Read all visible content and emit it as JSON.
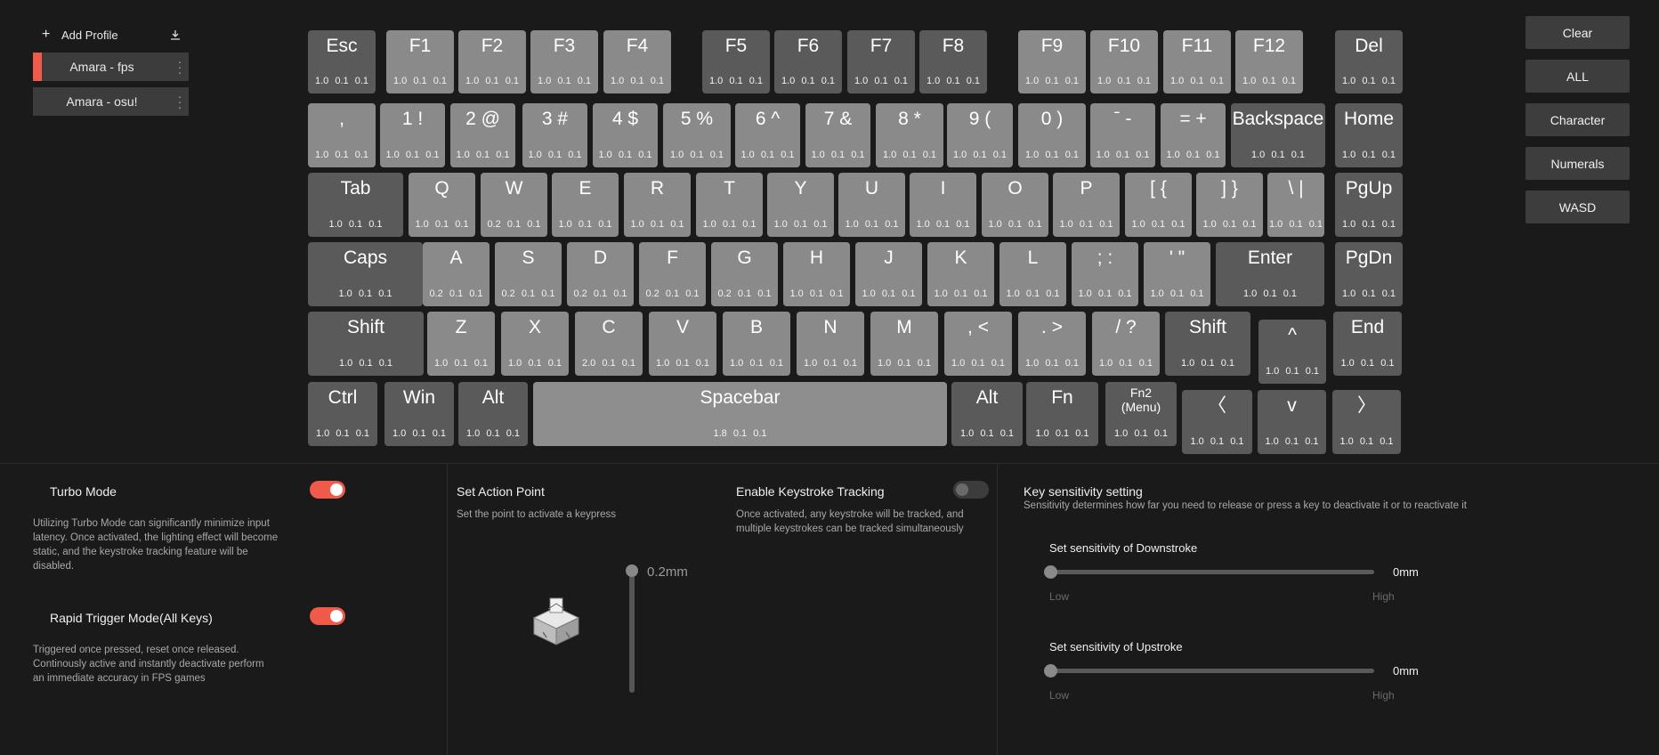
{
  "sidebar": {
    "add_profile": "Add Profile",
    "profiles": [
      {
        "name": "Amara - fps",
        "active": true
      },
      {
        "name": "Amara - osu!",
        "active": false
      }
    ]
  },
  "right_buttons": [
    "Clear",
    "ALL",
    "Character",
    "Numerals",
    "WASD"
  ],
  "keys": [
    {
      "l": "Esc",
      "v": "1.0  0.1  0.1",
      "s": "dark"
    },
    {
      "l": "F1",
      "v": "1.0  0.1  0.1",
      "s": "light"
    },
    {
      "l": "F2",
      "v": "1.0  0.1  0.1",
      "s": "light"
    },
    {
      "l": "F3",
      "v": "1.0  0.1  0.1",
      "s": "light"
    },
    {
      "l": "F4",
      "v": "1.0  0.1  0.1",
      "s": "light"
    },
    {
      "l": "F5",
      "v": "1.0  0.1  0.1",
      "s": "dark"
    },
    {
      "l": "F6",
      "v": "1.0  0.1  0.1",
      "s": "dark"
    },
    {
      "l": "F7",
      "v": "1.0  0.1  0.1",
      "s": "dark"
    },
    {
      "l": "F8",
      "v": "1.0  0.1  0.1",
      "s": "dark"
    },
    {
      "l": "F9",
      "v": "1.0  0.1  0.1",
      "s": "light"
    },
    {
      "l": "F10",
      "v": "1.0  0.1  0.1",
      "s": "light"
    },
    {
      "l": "F11",
      "v": "1.0  0.1  0.1",
      "s": "light"
    },
    {
      "l": "F12",
      "v": "1.0  0.1  0.1",
      "s": "light"
    },
    {
      "l": "Del",
      "v": "1.0  0.1  0.1",
      "s": "dark"
    },
    {
      "l": ",",
      "v": "1.0  0.1  0.1",
      "s": "light"
    },
    {
      "l": "1 !",
      "v": "1.0  0.1  0.1",
      "s": "light"
    },
    {
      "l": "2 @",
      "v": "1.0  0.1  0.1",
      "s": "light"
    },
    {
      "l": "3 #",
      "v": "1.0  0.1  0.1",
      "s": "light"
    },
    {
      "l": "4 $",
      "v": "1.0  0.1  0.1",
      "s": "light"
    },
    {
      "l": "5 %",
      "v": "1.0  0.1  0.1",
      "s": "light"
    },
    {
      "l": "6 ^",
      "v": "1.0  0.1  0.1",
      "s": "light"
    },
    {
      "l": "7 &",
      "v": "1.0  0.1  0.1",
      "s": "light"
    },
    {
      "l": "8 *",
      "v": "1.0  0.1  0.1",
      "s": "light"
    },
    {
      "l": "9 (",
      "v": "1.0  0.1  0.1",
      "s": "light"
    },
    {
      "l": "0 )",
      "v": "1.0  0.1  0.1",
      "s": "light"
    },
    {
      "l": "ˉ -",
      "v": "1.0  0.1  0.1",
      "s": "light"
    },
    {
      "l": "= +",
      "v": "1.0  0.1  0.1",
      "s": "light"
    },
    {
      "l": "Backspace",
      "v": "1.0  0.1  0.1",
      "s": "dark"
    },
    {
      "l": "Home",
      "v": "1.0  0.1  0.1",
      "s": "dark"
    },
    {
      "l": "Tab",
      "v": "1.0  0.1  0.1",
      "s": "dark"
    },
    {
      "l": "Q",
      "v": "1.0  0.1  0.1",
      "s": "light"
    },
    {
      "l": "W",
      "v": "0.2  0.1  0.1",
      "s": "light"
    },
    {
      "l": "E",
      "v": "1.0  0.1  0.1",
      "s": "light"
    },
    {
      "l": "R",
      "v": "1.0  0.1  0.1",
      "s": "light"
    },
    {
      "l": "T",
      "v": "1.0  0.1  0.1",
      "s": "light"
    },
    {
      "l": "Y",
      "v": "1.0  0.1  0.1",
      "s": "light"
    },
    {
      "l": "U",
      "v": "1.0  0.1  0.1",
      "s": "light"
    },
    {
      "l": "I",
      "v": "1.0  0.1  0.1",
      "s": "light"
    },
    {
      "l": "O",
      "v": "1.0  0.1  0.1",
      "s": "light"
    },
    {
      "l": "P",
      "v": "1.0  0.1  0.1",
      "s": "light"
    },
    {
      "l": "[ {",
      "v": "1.0  0.1  0.1",
      "s": "light"
    },
    {
      "l": "] }",
      "v": "1.0  0.1  0.1",
      "s": "light"
    },
    {
      "l": "\\ |",
      "v": "1.0  0.1  0.1",
      "s": "light"
    },
    {
      "l": "PgUp",
      "v": "1.0  0.1  0.1",
      "s": "dark"
    },
    {
      "l": "Caps",
      "v": "1.0  0.1  0.1",
      "s": "dark"
    },
    {
      "l": "A",
      "v": "0.2  0.1  0.1",
      "s": "light"
    },
    {
      "l": "S",
      "v": "0.2  0.1  0.1",
      "s": "light"
    },
    {
      "l": "D",
      "v": "0.2  0.1  0.1",
      "s": "light"
    },
    {
      "l": "F",
      "v": "0.2  0.1  0.1",
      "s": "light"
    },
    {
      "l": "G",
      "v": "0.2  0.1  0.1",
      "s": "light"
    },
    {
      "l": "H",
      "v": "1.0  0.1  0.1",
      "s": "light"
    },
    {
      "l": "J",
      "v": "1.0  0.1  0.1",
      "s": "light"
    },
    {
      "l": "K",
      "v": "1.0  0.1  0.1",
      "s": "light"
    },
    {
      "l": "L",
      "v": "1.0  0.1  0.1",
      "s": "light"
    },
    {
      "l": "; :",
      "v": "1.0  0.1  0.1",
      "s": "light"
    },
    {
      "l": "' \"",
      "v": "1.0  0.1  0.1",
      "s": "light"
    },
    {
      "l": "Enter",
      "v": "1.0  0.1  0.1",
      "s": "dark"
    },
    {
      "l": "PgDn",
      "v": "1.0  0.1  0.1",
      "s": "dark"
    },
    {
      "l": "Shift",
      "v": "1.0  0.1  0.1",
      "s": "dark"
    },
    {
      "l": "Z",
      "v": "1.0  0.1  0.1",
      "s": "light"
    },
    {
      "l": "X",
      "v": "1.0  0.1  0.1",
      "s": "light"
    },
    {
      "l": "C",
      "v": "2.0  0.1  0.1",
      "s": "light"
    },
    {
      "l": "V",
      "v": "1.0  0.1  0.1",
      "s": "light"
    },
    {
      "l": "B",
      "v": "1.0  0.1  0.1",
      "s": "light"
    },
    {
      "l": "N",
      "v": "1.0  0.1  0.1",
      "s": "light"
    },
    {
      "l": "M",
      "v": "1.0  0.1  0.1",
      "s": "light"
    },
    {
      "l": ", <",
      "v": "1.0  0.1  0.1",
      "s": "light"
    },
    {
      "l": ". >",
      "v": "1.0  0.1  0.1",
      "s": "light"
    },
    {
      "l": "/ ?",
      "v": "1.0  0.1  0.1",
      "s": "light"
    },
    {
      "l": "Shift",
      "v": "1.0  0.1  0.1",
      "s": "dark"
    },
    {
      "l": "^",
      "v": "1.0  0.1  0.1",
      "s": "dark"
    },
    {
      "l": "End",
      "v": "1.0  0.1  0.1",
      "s": "dark"
    },
    {
      "l": "Ctrl",
      "v": "1.0  0.1  0.1",
      "s": "dark"
    },
    {
      "l": "Win",
      "v": "1.0  0.1  0.1",
      "s": "dark"
    },
    {
      "l": "Alt",
      "v": "1.0  0.1  0.1",
      "s": "dark"
    },
    {
      "l": "Spacebar",
      "v": "1.8  0.1  0.1",
      "s": "space"
    },
    {
      "l": "Alt",
      "v": "1.0  0.1  0.1",
      "s": "dark"
    },
    {
      "l": "Fn",
      "v": "1.0  0.1  0.1",
      "s": "dark"
    },
    {
      "l": "Fn2\n(Menu)",
      "v": "1.0  0.1  0.1",
      "s": "dark"
    },
    {
      "l": "〈",
      "v": "1.0  0.1  0.1",
      "s": "dark"
    },
    {
      "l": "v",
      "v": "1.0  0.1  0.1",
      "s": "dark"
    },
    {
      "l": "〉",
      "v": "1.0  0.1  0.1",
      "s": "dark"
    }
  ],
  "turbo": {
    "title": "Turbo Mode",
    "desc": "Utilizing Turbo Mode can significantly minimize input latency. Once activated, the lighting effect will become static, and the keystroke tracking feature will be disabled.",
    "on": true
  },
  "rapid": {
    "title": "Rapid Trigger Mode(All Keys)",
    "desc": "Triggered once pressed, reset once released. Continously active and instantly deactivate perform an immediate accuracy in FPS games",
    "on": true
  },
  "action_point": {
    "title": "Set Action Point",
    "desc": "Set the point to activate a keypress",
    "value": "0.2mm"
  },
  "tracking": {
    "title": "Enable Keystroke Tracking",
    "desc": "Once activated, any keystroke will be tracked, and multiple keystrokes can be tracked simultaneously",
    "on": false
  },
  "sensitivity": {
    "title": "Key sensitivity setting",
    "desc": "Sensitivity determines how far you need to release or press a key to deactivate it or to reactivate it",
    "downstroke": {
      "label": "Set sensitivity of Downstroke",
      "value": "0mm",
      "low": "Low",
      "high": "High"
    },
    "upstroke": {
      "label": "Set sensitivity of Upstroke",
      "value": "0mm",
      "low": "Low",
      "high": "High"
    }
  },
  "colors": {
    "accent": "#ef5a4a",
    "key_light": "#8a8a8a",
    "key_dark": "#5a5a5a",
    "bg": "#1a1a1a"
  }
}
